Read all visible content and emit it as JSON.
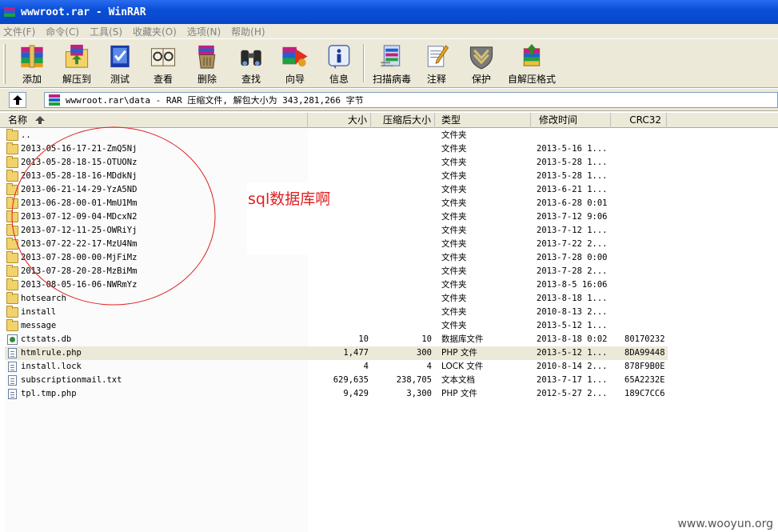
{
  "window": {
    "title": "wwwroot.rar - WinRAR"
  },
  "menu": [
    "文件(F)",
    "命令(C)",
    "工具(S)",
    "收藏夹(O)",
    "选项(N)",
    "帮助(H)"
  ],
  "toolbar": {
    "add": "添加",
    "extract_to": "解压到",
    "test": "测试",
    "view": "查看",
    "delete": "删除",
    "find": "查找",
    "wizard": "向导",
    "info": "信息",
    "virus_scan": "扫描病毒",
    "comment": "注释",
    "protect": "保护",
    "sfx": "自解压格式"
  },
  "address": {
    "text": "wwwroot.rar\\data - RAR 压缩文件, 解包大小为 343,281,266 字节"
  },
  "columns": {
    "name": "名称",
    "size": "大小",
    "packed": "压缩后大小",
    "type": "类型",
    "modified": "修改时间",
    "crc": "CRC32"
  },
  "rows": [
    {
      "name": "..",
      "size": "",
      "packed": "",
      "type": "文件夹",
      "modified": "",
      "crc": "",
      "kind": "folder"
    },
    {
      "name": "2013-05-16-17-21-ZmQ5Nj",
      "size": "",
      "packed": "",
      "type": "文件夹",
      "modified": "2013-5-16 1...",
      "crc": "",
      "kind": "folder"
    },
    {
      "name": "2013-05-28-18-15-OTUONz",
      "size": "",
      "packed": "",
      "type": "文件夹",
      "modified": "2013-5-28 1...",
      "crc": "",
      "kind": "folder"
    },
    {
      "name": "2013-05-28-18-16-MDdkNj",
      "size": "",
      "packed": "",
      "type": "文件夹",
      "modified": "2013-5-28 1...",
      "crc": "",
      "kind": "folder"
    },
    {
      "name": "2013-06-21-14-29-YzA5ND",
      "size": "",
      "packed": "",
      "type": "文件夹",
      "modified": "2013-6-21 1...",
      "crc": "",
      "kind": "folder"
    },
    {
      "name": "2013-06-28-00-01-MmU1Mm",
      "size": "",
      "packed": "",
      "type": "文件夹",
      "modified": "2013-6-28 0:01",
      "crc": "",
      "kind": "folder"
    },
    {
      "name": "2013-07-12-09-04-MDcxN2",
      "size": "",
      "packed": "",
      "type": "文件夹",
      "modified": "2013-7-12 9:06",
      "crc": "",
      "kind": "folder"
    },
    {
      "name": "2013-07-12-11-25-OWRiYj",
      "size": "",
      "packed": "",
      "type": "文件夹",
      "modified": "2013-7-12 1...",
      "crc": "",
      "kind": "folder"
    },
    {
      "name": "2013-07-22-22-17-MzU4Nm",
      "size": "",
      "packed": "",
      "type": "文件夹",
      "modified": "2013-7-22 2...",
      "crc": "",
      "kind": "folder"
    },
    {
      "name": "2013-07-28-00-00-MjFiMz",
      "size": "",
      "packed": "",
      "type": "文件夹",
      "modified": "2013-7-28 0:00",
      "crc": "",
      "kind": "folder"
    },
    {
      "name": "2013-07-28-20-28-MzBiMm",
      "size": "",
      "packed": "",
      "type": "文件夹",
      "modified": "2013-7-28 2...",
      "crc": "",
      "kind": "folder"
    },
    {
      "name": "2013-08-05-16-06-NWRmYz",
      "size": "",
      "packed": "",
      "type": "文件夹",
      "modified": "2013-8-5 16:06",
      "crc": "",
      "kind": "folder"
    },
    {
      "name": "hotsearch",
      "size": "",
      "packed": "",
      "type": "文件夹",
      "modified": "2013-8-18 1...",
      "crc": "",
      "kind": "folder"
    },
    {
      "name": "install",
      "size": "",
      "packed": "",
      "type": "文件夹",
      "modified": "2010-8-13 2...",
      "crc": "",
      "kind": "folder"
    },
    {
      "name": "message",
      "size": "",
      "packed": "",
      "type": "文件夹",
      "modified": "2013-5-12 1...",
      "crc": "",
      "kind": "folder"
    },
    {
      "name": "ctstats.db",
      "size": "10",
      "packed": "10",
      "type": "数据库文件",
      "modified": "2013-8-18 0:02",
      "crc": "80170232",
      "kind": "db"
    },
    {
      "name": "htmlrule.php",
      "size": "1,477",
      "packed": "300",
      "type": "PHP 文件",
      "modified": "2013-5-12 1...",
      "crc": "8DA99448",
      "kind": "file",
      "selected": true
    },
    {
      "name": "install.lock",
      "size": "4",
      "packed": "4",
      "type": "LOCK 文件",
      "modified": "2010-8-14 2...",
      "crc": "878F9B0E",
      "kind": "file"
    },
    {
      "name": "subscriptionmail.txt",
      "size": "629,635",
      "packed": "238,705",
      "type": "文本文档",
      "modified": "2013-7-17 1...",
      "crc": "65A2232E",
      "kind": "file"
    },
    {
      "name": "tpl.tmp.php",
      "size": "9,429",
      "packed": "3,300",
      "type": "PHP 文件",
      "modified": "2012-5-27 2...",
      "crc": "189C7CC6",
      "kind": "file"
    }
  ],
  "annotation": {
    "text": "sql数据库啊",
    "color": "#e02020"
  },
  "watermark": "www.wooyun.org"
}
